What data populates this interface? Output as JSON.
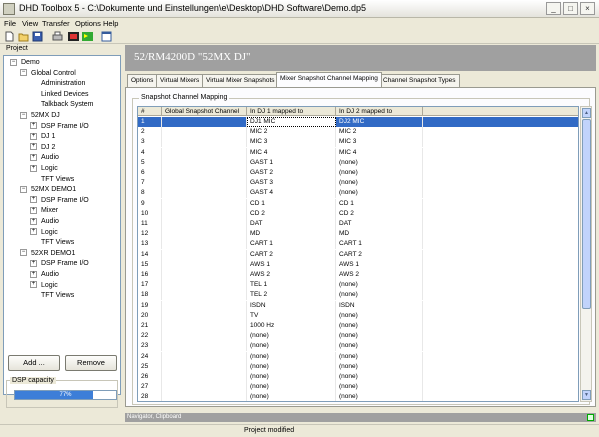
{
  "window": {
    "title": "DHD Toolbox 5 - C:\\Dokumente und Einstellungen\\e\\Desktop\\DHD Software\\Demo.dp5",
    "min": "_",
    "max": "□",
    "close": "×"
  },
  "menu": [
    "File",
    "View",
    "Transfer",
    "Options",
    "Help"
  ],
  "toolbar": {
    "icons": [
      "new-file-icon",
      "open-folder-icon",
      "save-icon",
      "print-icon",
      "transfer-icon",
      "flag-icon",
      "window-icon"
    ]
  },
  "project": {
    "caption": "Project",
    "tree": [
      {
        "label": "Demo",
        "indent": 0,
        "exp": "−"
      },
      {
        "label": "Global Control",
        "indent": 1,
        "exp": "−"
      },
      {
        "label": "Administration",
        "indent": 2,
        "exp": ""
      },
      {
        "label": "Linked Devices",
        "indent": 2,
        "exp": ""
      },
      {
        "label": "Talkback System",
        "indent": 2,
        "exp": ""
      },
      {
        "label": "52MX DJ",
        "indent": 1,
        "exp": "−"
      },
      {
        "label": "DSP Frame I/O",
        "indent": 2,
        "exp": "+"
      },
      {
        "label": "DJ 1",
        "indent": 2,
        "exp": "+"
      },
      {
        "label": "DJ 2",
        "indent": 2,
        "exp": "+"
      },
      {
        "label": "Audio",
        "indent": 2,
        "exp": "+"
      },
      {
        "label": "Logic",
        "indent": 2,
        "exp": "+"
      },
      {
        "label": "TFT Views",
        "indent": 2,
        "exp": ""
      },
      {
        "label": "52MX DEMO1",
        "indent": 1,
        "exp": "−"
      },
      {
        "label": "DSP Frame I/O",
        "indent": 2,
        "exp": "+"
      },
      {
        "label": "Mixer",
        "indent": 2,
        "exp": "+"
      },
      {
        "label": "Audio",
        "indent": 2,
        "exp": "+"
      },
      {
        "label": "Logic",
        "indent": 2,
        "exp": "+"
      },
      {
        "label": "TFT Views",
        "indent": 2,
        "exp": ""
      },
      {
        "label": "52XR DEMO1",
        "indent": 1,
        "exp": "−"
      },
      {
        "label": "DSP Frame I/O",
        "indent": 2,
        "exp": "+"
      },
      {
        "label": "Audio",
        "indent": 2,
        "exp": "+"
      },
      {
        "label": "Logic",
        "indent": 2,
        "exp": "+"
      },
      {
        "label": "TFT Views",
        "indent": 2,
        "exp": ""
      }
    ],
    "add_label": "Add ...",
    "remove_label": "Remove"
  },
  "dsp": {
    "label": "DSP capacity",
    "percent_text": "77%",
    "fraction": 0.77
  },
  "device": {
    "title": "52/RM4200D \"52MX DJ\""
  },
  "tabs": [
    {
      "label": "Options",
      "active": false
    },
    {
      "label": "Virtual Mixers",
      "active": false
    },
    {
      "label": "Virtual Mixer Snapshots",
      "active": false
    },
    {
      "label": "Mixer Snapshot Channel Mapping",
      "active": true
    },
    {
      "label": "Channel Snapshot Types",
      "active": false
    }
  ],
  "mapping": {
    "group_label": "Snapshot Channel Mapping",
    "columns": [
      "#",
      "Global Snapshot Channel",
      "In DJ 1 mapped to",
      "In DJ 2 mapped to"
    ],
    "rows": [
      [
        "1",
        "",
        "DJ1 MIC",
        "DJ2 MIC"
      ],
      [
        "2",
        "",
        "MIC 2",
        "MIC 2"
      ],
      [
        "3",
        "",
        "MIC 3",
        "MIC 3"
      ],
      [
        "4",
        "",
        "MIC 4",
        "MIC 4"
      ],
      [
        "5",
        "",
        "GAST 1",
        "(none)"
      ],
      [
        "6",
        "",
        "GAST 2",
        "(none)"
      ],
      [
        "7",
        "",
        "GAST 3",
        "(none)"
      ],
      [
        "8",
        "",
        "GAST 4",
        "(none)"
      ],
      [
        "9",
        "",
        "CD 1",
        "CD 1"
      ],
      [
        "10",
        "",
        "CD 2",
        "CD 2"
      ],
      [
        "11",
        "",
        "DAT",
        "DAT"
      ],
      [
        "12",
        "",
        "MD",
        "MD"
      ],
      [
        "13",
        "",
        "CART 1",
        "CART 1"
      ],
      [
        "14",
        "",
        "CART 2",
        "CART 2"
      ],
      [
        "15",
        "",
        "AWS 1",
        "AWS 1"
      ],
      [
        "16",
        "",
        "AWS 2",
        "AWS 2"
      ],
      [
        "17",
        "",
        "TEL 1",
        "(none)"
      ],
      [
        "18",
        "",
        "TEL 2",
        "(none)"
      ],
      [
        "19",
        "",
        "ISDN",
        "ISDN"
      ],
      [
        "20",
        "",
        "TV",
        "(none)"
      ],
      [
        "21",
        "",
        "1000 Hz",
        "(none)"
      ],
      [
        "22",
        "",
        "(none)",
        "(none)"
      ],
      [
        "23",
        "",
        "(none)",
        "(none)"
      ],
      [
        "24",
        "",
        "(none)",
        "(none)"
      ],
      [
        "25",
        "",
        "(none)",
        "(none)"
      ],
      [
        "26",
        "",
        "(none)",
        "(none)"
      ],
      [
        "27",
        "",
        "(none)",
        "(none)"
      ],
      [
        "28",
        "",
        "(none)",
        "(none)"
      ]
    ],
    "selected_row": 0
  },
  "navigator": {
    "label": "Navigator, Clipboard"
  },
  "status": {
    "text": "Project modified"
  }
}
